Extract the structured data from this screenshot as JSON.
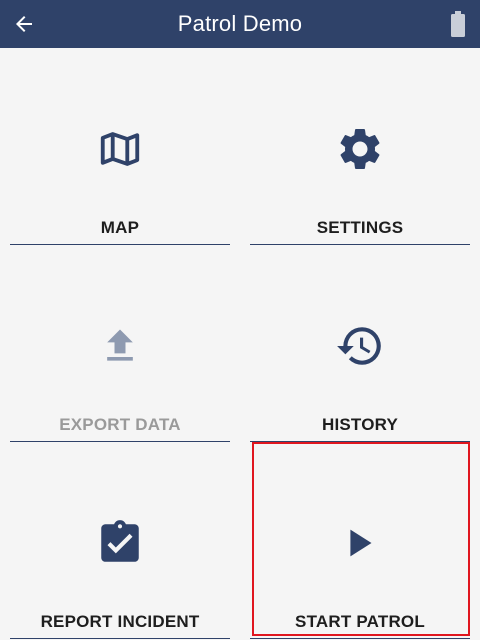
{
  "header": {
    "title": "Patrol Demo",
    "back_icon": "arrow-left-icon",
    "status_icon": "battery-icon"
  },
  "colors": {
    "appbar": "#2f4269",
    "icon": "#2f4269",
    "icon_disabled": "#8e9ab0",
    "label": "#1e1e1e",
    "label_disabled": "#9a9a9a",
    "highlight": "#e0161f"
  },
  "tiles": [
    {
      "label": "MAP",
      "icon": "map-icon",
      "enabled": true
    },
    {
      "label": "SETTINGS",
      "icon": "gear-icon",
      "enabled": true
    },
    {
      "label": "EXPORT DATA",
      "icon": "upload-icon",
      "enabled": false
    },
    {
      "label": "HISTORY",
      "icon": "history-icon",
      "enabled": true
    },
    {
      "label": "REPORT INCIDENT",
      "icon": "clipboard-check-icon",
      "enabled": true
    },
    {
      "label": "START PATROL",
      "icon": "play-icon",
      "enabled": true,
      "highlighted": true
    }
  ]
}
